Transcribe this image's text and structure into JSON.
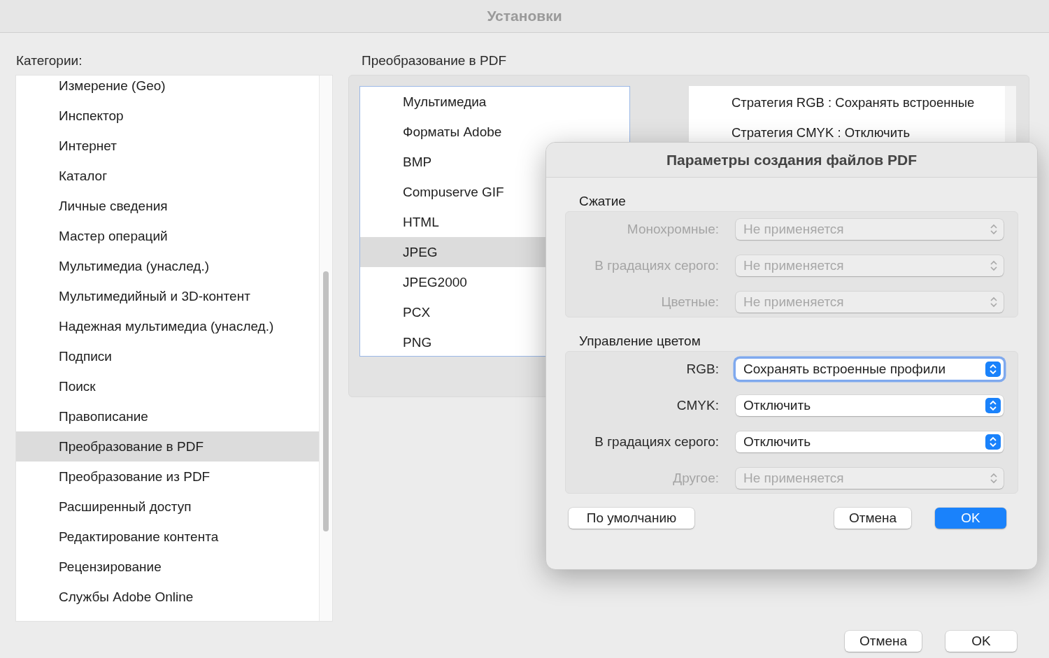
{
  "window": {
    "title": "Установки"
  },
  "categories": {
    "label": "Категории:",
    "items": [
      {
        "label": "Измерение (Geo)",
        "selected": false
      },
      {
        "label": "Инспектор",
        "selected": false
      },
      {
        "label": "Интернет",
        "selected": false
      },
      {
        "label": "Каталог",
        "selected": false
      },
      {
        "label": "Личные сведения",
        "selected": false
      },
      {
        "label": "Мастер операций",
        "selected": false
      },
      {
        "label": "Мультимедиа (унаслед.)",
        "selected": false
      },
      {
        "label": "Мультимедийный и 3D-контент",
        "selected": false
      },
      {
        "label": "Надежная мультимедиа (унаслед.)",
        "selected": false
      },
      {
        "label": "Подписи",
        "selected": false
      },
      {
        "label": "Поиск",
        "selected": false
      },
      {
        "label": "Правописание",
        "selected": false
      },
      {
        "label": "Преобразование в PDF",
        "selected": true
      },
      {
        "label": "Преобразование из PDF",
        "selected": false
      },
      {
        "label": "Расширенный доступ",
        "selected": false
      },
      {
        "label": "Редактирование контента",
        "selected": false
      },
      {
        "label": "Рецензирование",
        "selected": false
      },
      {
        "label": "Службы Adobe Online",
        "selected": false
      }
    ]
  },
  "section": {
    "title": "Преобразование в PDF",
    "formats": [
      {
        "label": "Мультимедиа",
        "selected": false
      },
      {
        "label": "Форматы Adobe",
        "selected": false
      },
      {
        "label": "BMP",
        "selected": false
      },
      {
        "label": "Compuserve GIF",
        "selected": false
      },
      {
        "label": "HTML",
        "selected": false
      },
      {
        "label": "JPEG",
        "selected": true
      },
      {
        "label": "JPEG2000",
        "selected": false
      },
      {
        "label": "PCX",
        "selected": false
      },
      {
        "label": "PNG",
        "selected": false
      }
    ],
    "settings": [
      "Стратегия RGB : Сохранять встроенные",
      "Стратегия CMYK : Отключить"
    ]
  },
  "buttons": [
    "Отмена",
    "OK"
  ],
  "dialog": {
    "title": "Параметры создания файлов PDF",
    "groups": [
      {
        "title": "Сжатие",
        "rows": [
          {
            "label": "Монохромные:",
            "value": "Не применяется",
            "disabled": true,
            "focused": false
          },
          {
            "label": "В градациях серого:",
            "value": "Не применяется",
            "disabled": true,
            "focused": false
          },
          {
            "label": "Цветные:",
            "value": "Не применяется",
            "disabled": true,
            "focused": false
          }
        ]
      },
      {
        "title": "Управление цветом",
        "rows": [
          {
            "label": "RGB:",
            "value": "Сохранять встроенные профили",
            "disabled": false,
            "focused": true
          },
          {
            "label": "CMYK:",
            "value": "Отключить",
            "disabled": false,
            "focused": false
          },
          {
            "label": "В градациях серого:",
            "value": "Отключить",
            "disabled": false,
            "focused": false
          },
          {
            "label": "Другое:",
            "value": "Не применяется",
            "disabled": true,
            "focused": false
          }
        ]
      }
    ],
    "buttons": [
      {
        "label": "По умолчанию",
        "kind": "secondary"
      },
      {
        "label": "Отмена",
        "kind": "secondary"
      },
      {
        "label": "OK",
        "kind": "primary"
      }
    ]
  }
}
